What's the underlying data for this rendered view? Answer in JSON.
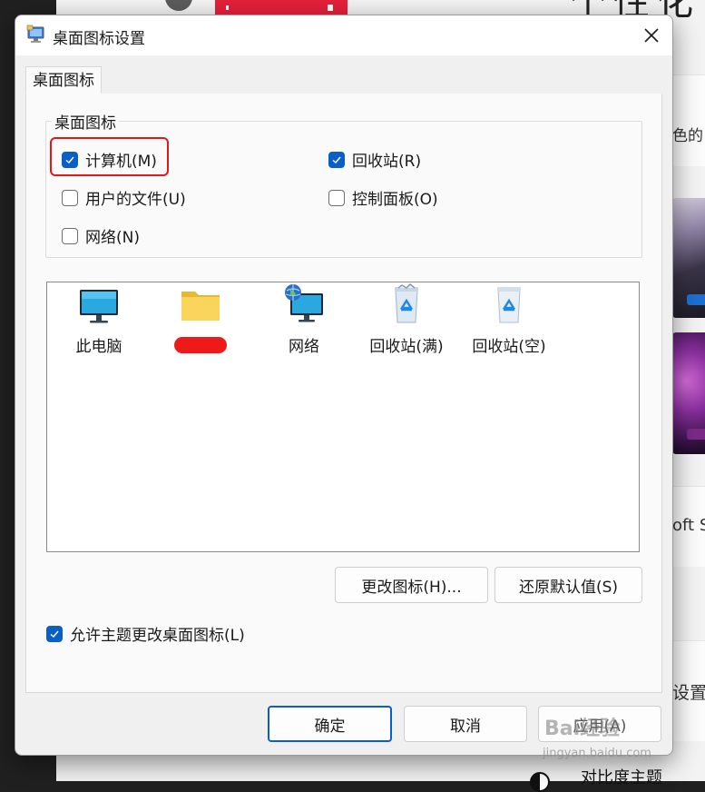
{
  "background": {
    "title_fragment": "个性化 > 主",
    "side_snippet_1": "色的",
    "side_snippet_2": "oft St",
    "side_snippet_3": "设置",
    "bottom_label": "对比度主题"
  },
  "dialog": {
    "title": "桌面图标设置",
    "tab_label": "桌面图标",
    "group_title": "桌面图标",
    "checkboxes": [
      {
        "label": "计算机(M)",
        "checked": true
      },
      {
        "label": "回收站(R)",
        "checked": true
      },
      {
        "label": "用户的文件(U)",
        "checked": false
      },
      {
        "label": "控制面板(O)",
        "checked": false
      },
      {
        "label": "网络(N)",
        "checked": false
      }
    ],
    "icons": [
      {
        "label": "此电脑",
        "icon": "monitor-icon"
      },
      {
        "label": "",
        "icon": "folder-icon",
        "redacted": true
      },
      {
        "label": "网络",
        "icon": "network-icon"
      },
      {
        "label": "回收站(满)",
        "icon": "recycle-bin-full-icon"
      },
      {
        "label": "回收站(空)",
        "icon": "recycle-bin-empty-icon"
      }
    ],
    "change_icon_label": "更改图标(H)...",
    "restore_default_label": "还原默认值(S)",
    "allow_theme_label": "允许主题更改桌面图标(L)",
    "allow_theme_checked": true,
    "ok_label": "确定",
    "cancel_label": "取消",
    "apply_label": "应用(A)"
  },
  "watermark": {
    "line1": "Bai经验",
    "line2": "jingyan.baidu.com"
  },
  "colors": {
    "accent": "#0a5ec8",
    "highlight": "#e4161a"
  }
}
